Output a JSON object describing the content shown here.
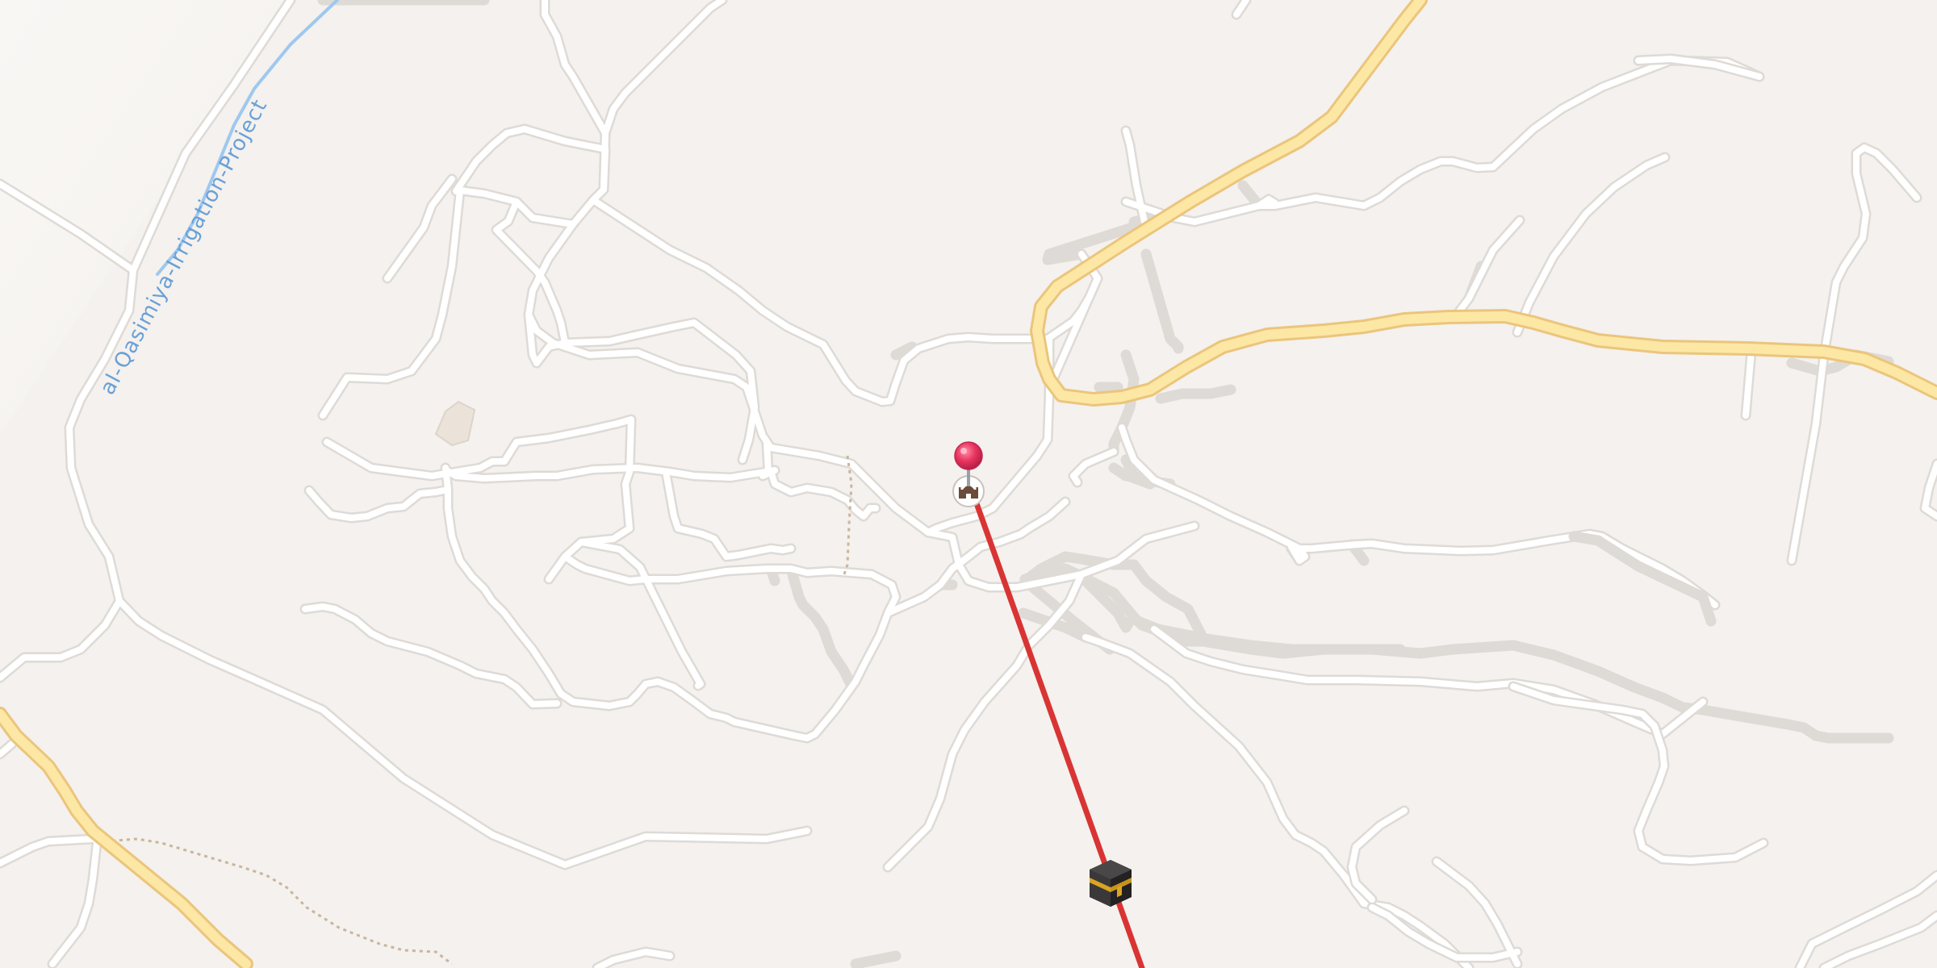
{
  "map": {
    "canal_label": "al-Qasimiya-Irrigation-Project"
  },
  "markers": {
    "location_pin": "location-pin-icon",
    "mosque": "mosque-icon",
    "kaaba": "kaaba-icon"
  },
  "colors": {
    "background": "#f4f1ee",
    "road_fill": "#ffffff",
    "road_casing": "#dedad5",
    "major_road_fill": "#fde7a4",
    "major_road_casing": "#ebc57c",
    "canal": "#9ec8ef",
    "qibla_line": "#d93434",
    "pin": "#e8335e",
    "footpath": "#c9b59c"
  }
}
